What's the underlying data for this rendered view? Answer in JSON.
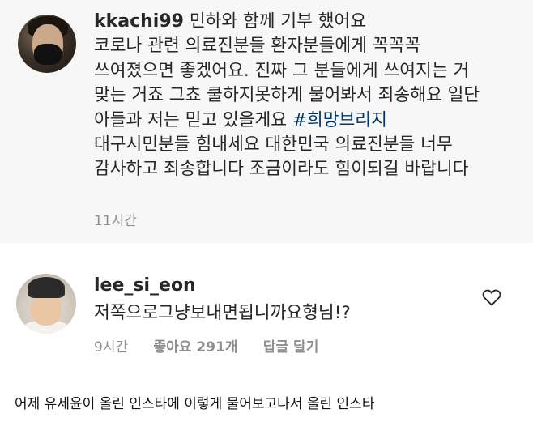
{
  "comment1": {
    "username": "kkachi99",
    "lines": [
      "민하와 함께 기부 했어요",
      "코로나 관련 의료진분들 환자분들에게 꼭꼭꼭",
      "쓰여졌으면 좋겠어요. 진짜 그 분들에게 쓰여지는 거",
      "맞는 거죠 그쵸 쿨하지못하게 물어봐서 죄송해요 일단",
      "아들과 저는 믿고 있을게요",
      "대구시민분들 힘내세요 대한민국 의료진분들 너무",
      "감사하고 죄송합니다 조금이라도 힘이되길 바랍니다"
    ],
    "hashtag": "#희망브리지",
    "time": "11시간"
  },
  "comment2": {
    "username": "lee_si_eon",
    "text": "저쪽으로그냥보내면됩니까요형님!?",
    "time": "9시간",
    "likes": "좋아요 291개",
    "reply": "답글 달기",
    "icon": "heart-outline-icon"
  },
  "caption": "어제 유세윤이 올린 인스타에 이렇게 물어보고나서 올린 인스타",
  "colors": {
    "top_background": "#f7f7f7",
    "hashtag": "#00376b",
    "meta": "#8e8e8e"
  }
}
